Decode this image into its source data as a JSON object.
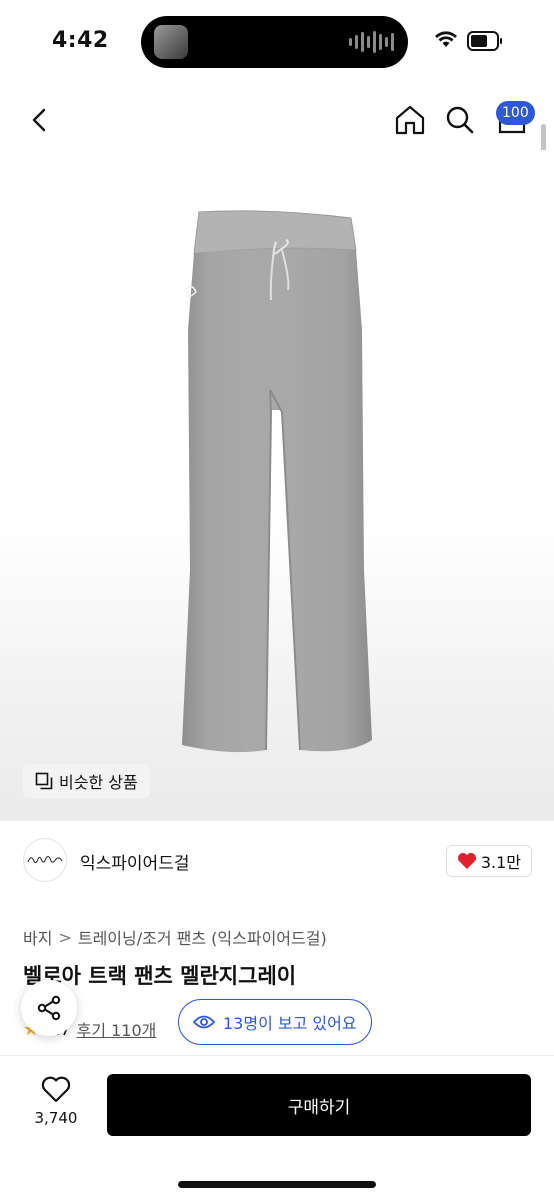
{
  "status_bar": {
    "time": "4:42"
  },
  "nav": {
    "back_icon": "chevron-left-icon",
    "home_icon": "home-icon",
    "search_icon": "search-icon",
    "cart_icon": "cart-icon",
    "cart_badge": "100",
    "badge_color": "#2f58d4"
  },
  "product_image": {
    "similar_label": "비슷한 상품"
  },
  "brand": {
    "name": "익스파이어드걸",
    "like_count": "3.1만",
    "heart_color": "#e0202a"
  },
  "breadcrumb": {
    "category": "바지",
    "separator": ">",
    "subcategory": "트레이닝/조거 팬츠 (익스파이어드걸)"
  },
  "product": {
    "title": "벨로아 트랙 팬츠 멜란지그레이",
    "rating": "4.7",
    "review_link": "후기 110개",
    "viewers": "13명이 보고 있어요"
  },
  "bottom_bar": {
    "wish_count": "3,740",
    "buy_label": "구매하기"
  }
}
